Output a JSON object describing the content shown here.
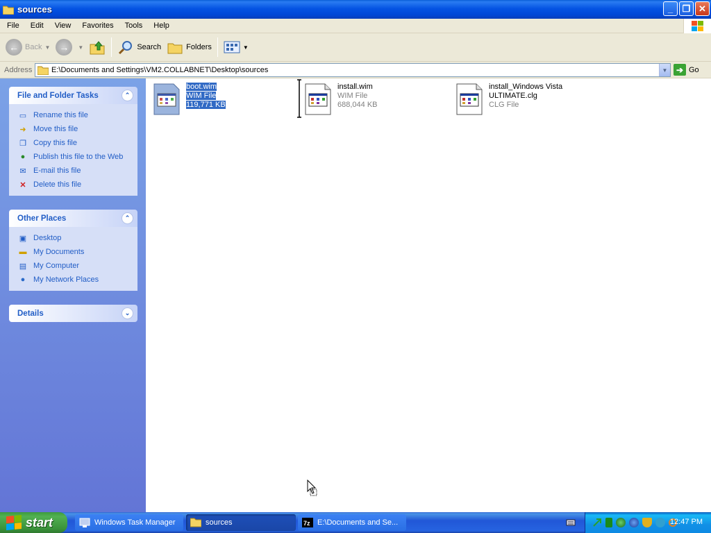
{
  "window": {
    "title": "sources"
  },
  "menu": [
    "File",
    "Edit",
    "View",
    "Favorites",
    "Tools",
    "Help"
  ],
  "toolbar": {
    "back": "Back",
    "search": "Search",
    "folders": "Folders"
  },
  "address": {
    "label": "Address",
    "path": "E:\\Documents and Settings\\VM2.COLLABNET\\Desktop\\sources",
    "go": "Go"
  },
  "left": {
    "file_tasks": {
      "title": "File and Folder Tasks",
      "items": [
        "Rename this file",
        "Move this file",
        "Copy this file",
        "Publish this file to the Web",
        "E-mail this file",
        "Delete this file"
      ]
    },
    "other_places": {
      "title": "Other Places",
      "items": [
        "Desktop",
        "My Documents",
        "My Computer",
        "My Network Places"
      ]
    },
    "details": {
      "title": "Details"
    }
  },
  "files": [
    {
      "name": "boot.wim",
      "type": "WIM File",
      "size": "119,771 KB",
      "selected": true
    },
    {
      "name": "install.wim",
      "type": "WIM File",
      "size": "688,044 KB",
      "selected": false
    },
    {
      "name": "install_Windows Vista",
      "name2": "ULTIMATE.clg",
      "type": "CLG File",
      "selected": false
    }
  ],
  "taskbar": {
    "start": "start",
    "tasks": [
      "Windows Task Manager",
      "sources",
      "E:\\Documents and Se..."
    ],
    "clock": "12:47 PM"
  }
}
